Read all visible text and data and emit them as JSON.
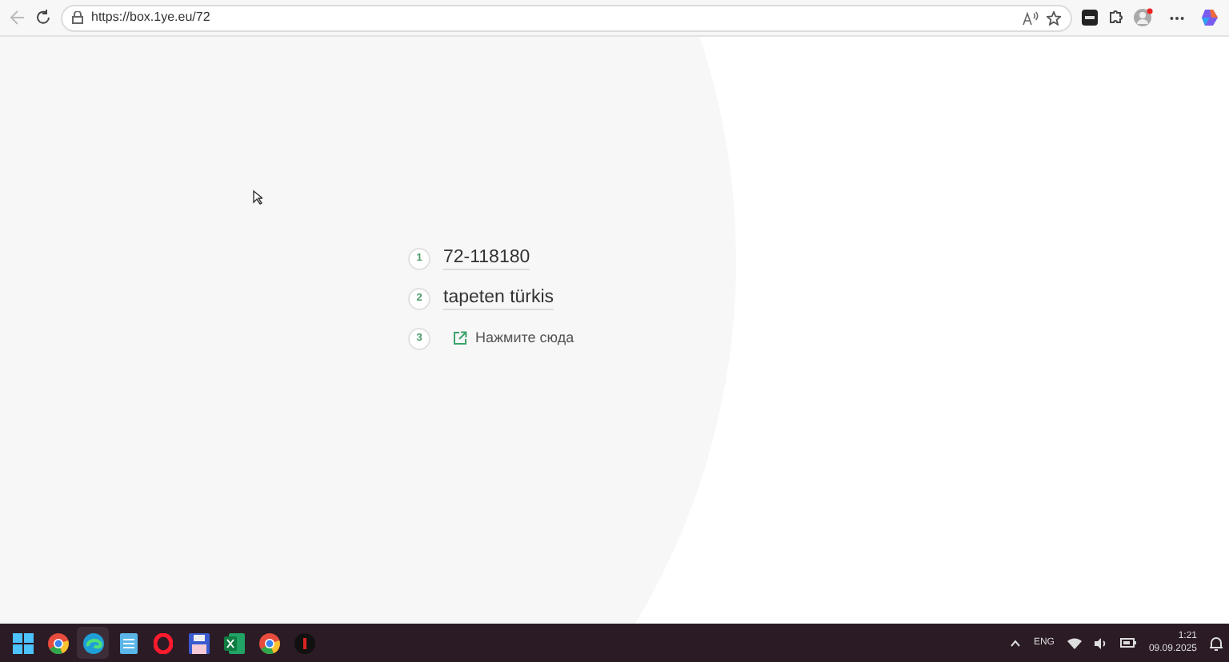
{
  "browser": {
    "url": "https://box.1ye.eu/72"
  },
  "steps": [
    {
      "number": "1",
      "kind": "text",
      "text": "72-118180"
    },
    {
      "number": "2",
      "kind": "text",
      "text": "tapeten türkis"
    },
    {
      "number": "3",
      "kind": "link",
      "text": "Нажмите сюда"
    }
  ],
  "taskbar": {
    "apps": [
      {
        "kind": "start",
        "selected": false
      },
      {
        "kind": "chrome",
        "selected": false
      },
      {
        "kind": "edge",
        "selected": true
      },
      {
        "kind": "notepad",
        "selected": false
      },
      {
        "kind": "opera",
        "selected": false
      },
      {
        "kind": "save",
        "selected": false
      },
      {
        "kind": "excel",
        "selected": false
      },
      {
        "kind": "chrome",
        "selected": false
      },
      {
        "kind": "dark",
        "selected": false
      }
    ],
    "language": "ENG",
    "time": "1:21",
    "date": "09.09.2025"
  }
}
